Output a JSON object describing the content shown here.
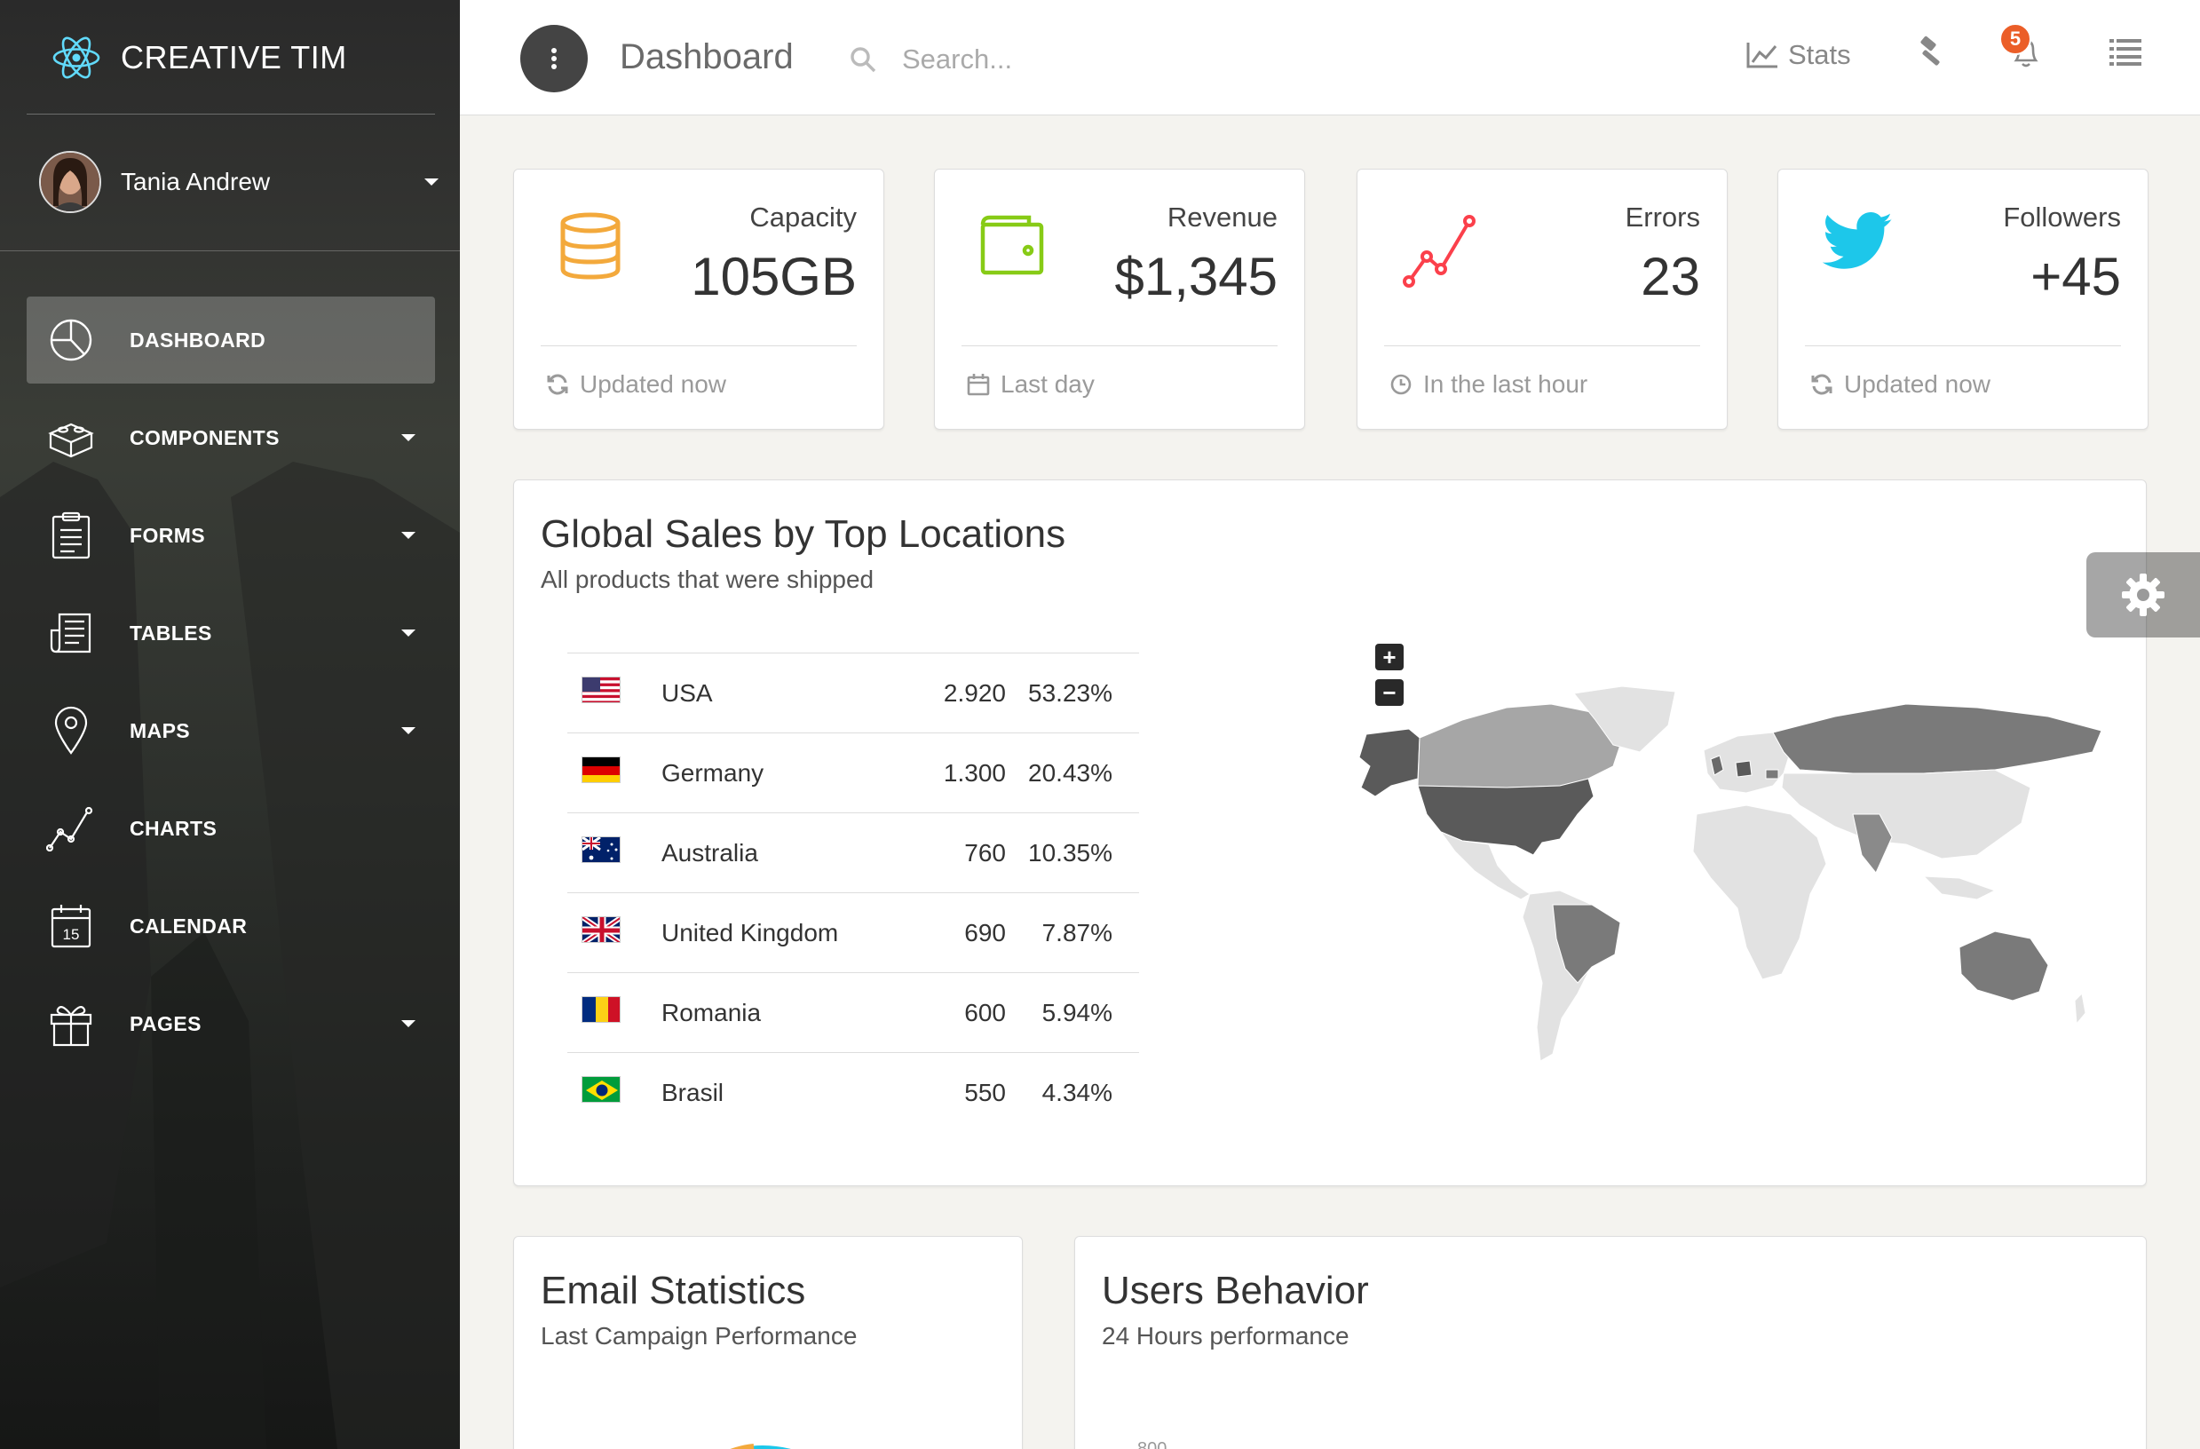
{
  "brand": {
    "name": "CREATIVE TIM"
  },
  "user": {
    "name": "Tania Andrew"
  },
  "nav": [
    {
      "label": "DASHBOARD",
      "icon": "pie-chart-icon",
      "active": true,
      "has_caret": false
    },
    {
      "label": "COMPONENTS",
      "icon": "lego-icon",
      "has_caret": true
    },
    {
      "label": "FORMS",
      "icon": "clipboard-icon",
      "has_caret": true
    },
    {
      "label": "TABLES",
      "icon": "newspaper-icon",
      "has_caret": true
    },
    {
      "label": "MAPS",
      "icon": "map-pin-icon",
      "has_caret": true
    },
    {
      "label": "CHARTS",
      "icon": "chart-line-icon",
      "has_caret": false
    },
    {
      "label": "CALENDAR",
      "icon": "calendar-icon",
      "has_caret": false
    },
    {
      "label": "PAGES",
      "icon": "gift-icon",
      "has_caret": true
    }
  ],
  "topbar": {
    "title": "Dashboard",
    "search_placeholder": "Search...",
    "stats_label": "Stats",
    "notifications_count": "5"
  },
  "stat_cards": [
    {
      "label": "Capacity",
      "value": "105GB",
      "footer": "Updated now",
      "icon": "database-icon",
      "color": "#f3a93c",
      "footer_icon": "refresh-icon"
    },
    {
      "label": "Revenue",
      "value": "$1,345",
      "footer": "Last day",
      "icon": "wallet-icon",
      "color": "#87cb16",
      "footer_icon": "calendar-icon"
    },
    {
      "label": "Errors",
      "value": "23",
      "footer": "In the last hour",
      "icon": "line-chart-icon",
      "color": "#fb404b",
      "footer_icon": "clock-icon"
    },
    {
      "label": "Followers",
      "value": "+45",
      "footer": "Updated now",
      "icon": "twitter-icon",
      "color": "#1dc7ea",
      "footer_icon": "refresh-icon"
    }
  ],
  "sales": {
    "title": "Global Sales by Top Locations",
    "subtitle": "All products that were shipped",
    "rows": [
      {
        "country": "USA",
        "sales": "2.920",
        "percent": "53.23%",
        "flag": "us"
      },
      {
        "country": "Germany",
        "sales": "1.300",
        "percent": "20.43%",
        "flag": "de"
      },
      {
        "country": "Australia",
        "sales": "760",
        "percent": "10.35%",
        "flag": "au"
      },
      {
        "country": "United Kingdom",
        "sales": "690",
        "percent": "7.87%",
        "flag": "gb"
      },
      {
        "country": "Romania",
        "sales": "600",
        "percent": "5.94%",
        "flag": "ro"
      },
      {
        "country": "Brasil",
        "sales": "550",
        "percent": "4.34%",
        "flag": "br"
      }
    ],
    "map_zoom_in": "+",
    "map_zoom_out": "−"
  },
  "email_stats": {
    "title": "Email Statistics",
    "subtitle": "Last Campaign Performance"
  },
  "users_behavior": {
    "title": "Users Behavior",
    "subtitle": "24 Hours performance",
    "axis_peek": "800"
  }
}
